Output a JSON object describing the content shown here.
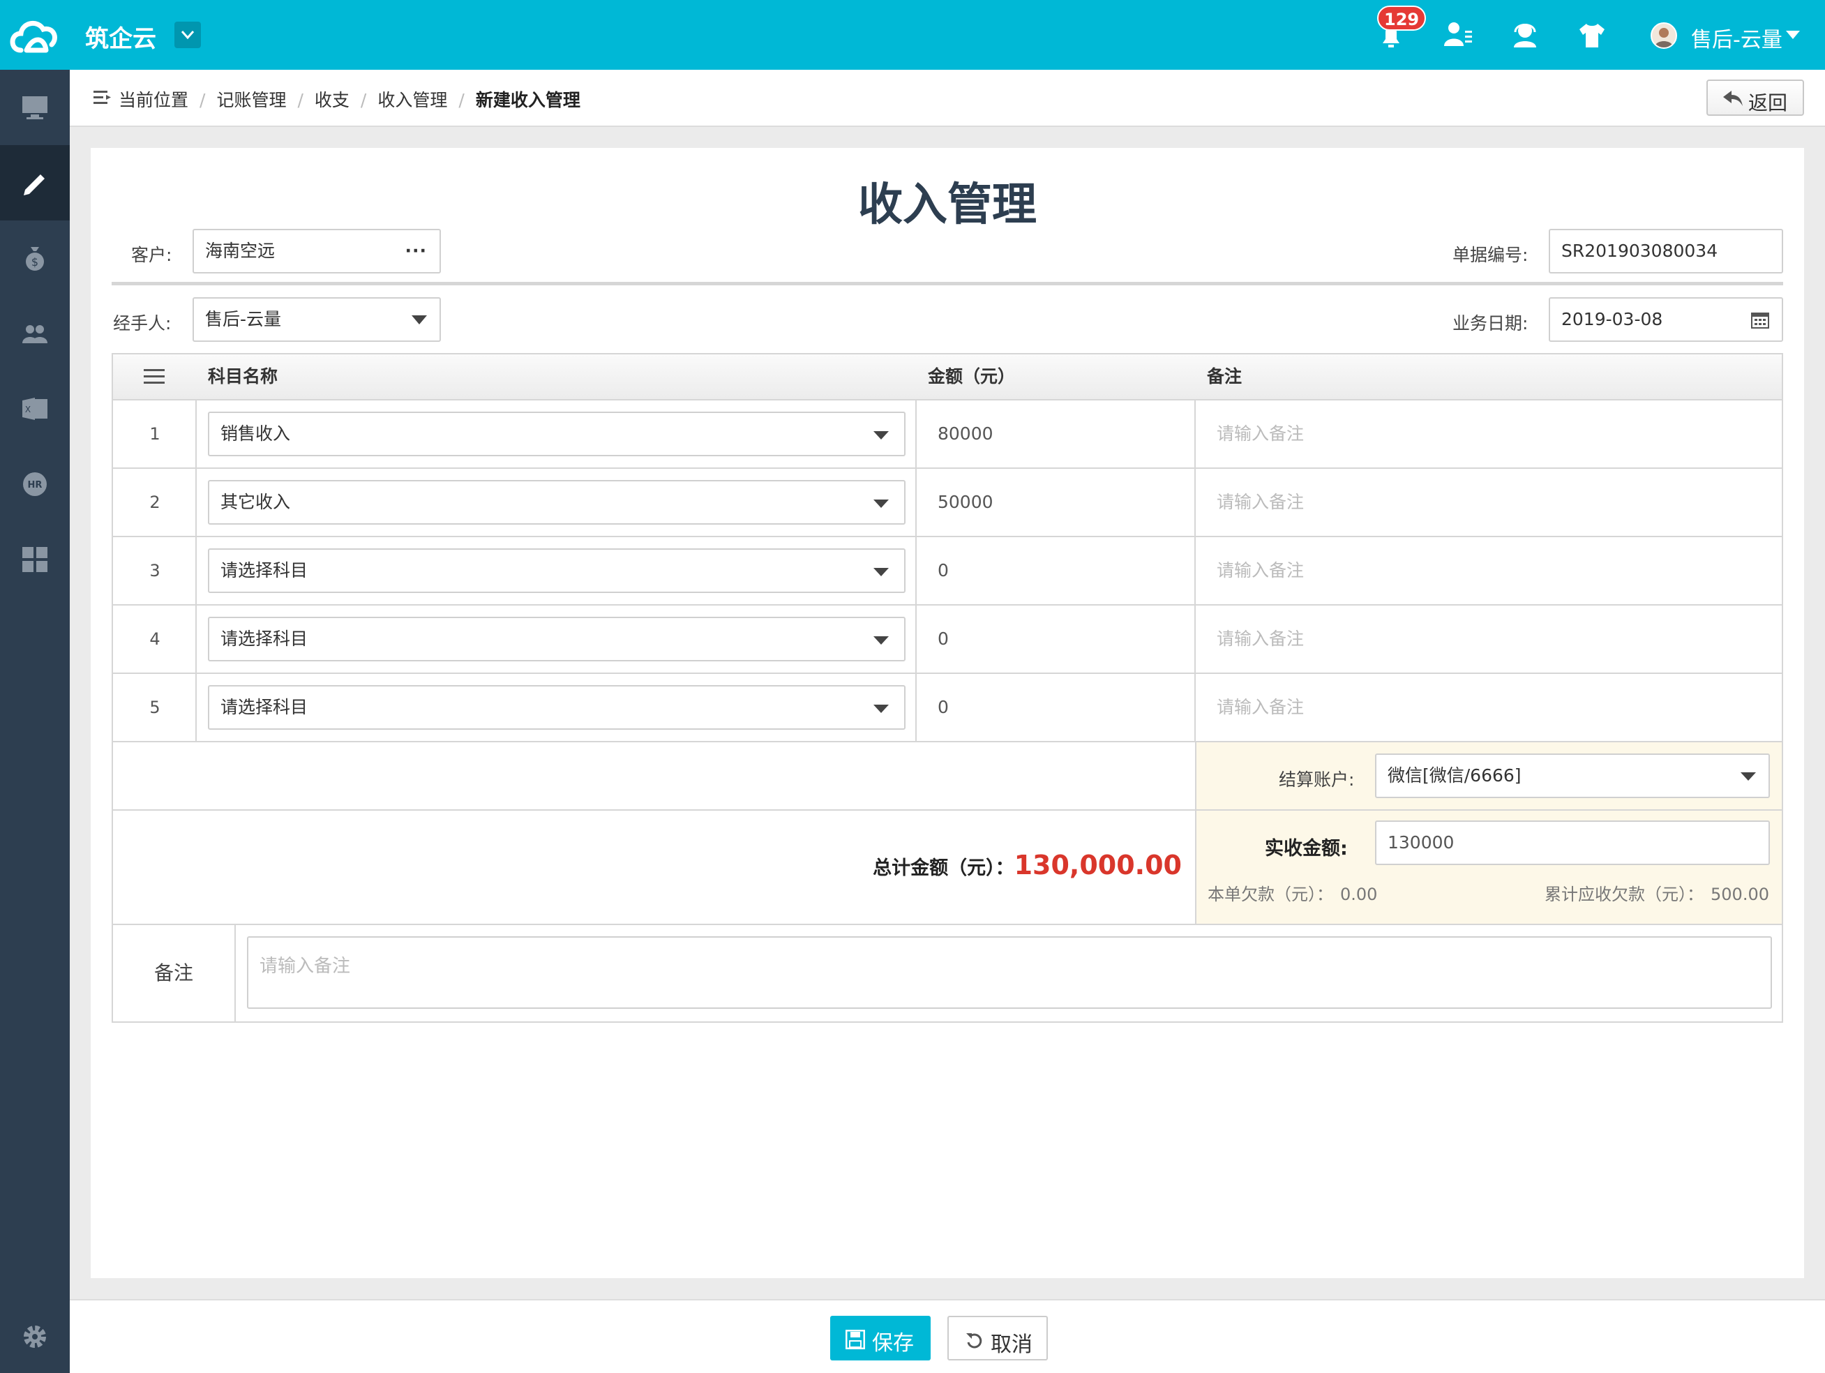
{
  "colors": {
    "accent": "#00b8d6",
    "sidebar": "#2d3e50",
    "total": "#d9362b",
    "badge": "#e53935",
    "summary_bg": "#fdf8e8"
  },
  "header": {
    "brand": "筑企云",
    "notification_count": "129",
    "user_name": "售后-云量",
    "icons": [
      "cloud-logo-icon",
      "chevron-down-icon",
      "bell-icon",
      "user-list-icon",
      "support-icon",
      "shirt-icon",
      "avatar",
      "caret-down-icon"
    ]
  },
  "sidebar": {
    "items": [
      "monitor-icon",
      "pencil-icon",
      "money-bag-icon",
      "group-icon",
      "excel-icon",
      "hr-icon",
      "grid-icon"
    ],
    "footer": "gear-icon"
  },
  "breadcrumb": {
    "items": [
      "当前位置",
      "记账管理",
      "收支",
      "收入管理",
      "新建收入管理"
    ],
    "back_label": "返回"
  },
  "form": {
    "title": "收入管理",
    "customer_label": "客户:",
    "customer_value": "海南空远",
    "doc_no_label": "单据编号:",
    "doc_no_value": "SR201903080034",
    "handler_label": "经手人:",
    "handler_value": "售后-云量",
    "date_label": "业务日期:",
    "date_value": "2019-03-08"
  },
  "table": {
    "columns": [
      "科目名称",
      "金额（元）",
      "备注"
    ],
    "rows": [
      {
        "index": "1",
        "subject": "销售收入",
        "amount": "80000",
        "note_placeholder": "请输入备注"
      },
      {
        "index": "2",
        "subject": "其它收入",
        "amount": "50000",
        "note_placeholder": "请输入备注"
      },
      {
        "index": "3",
        "subject": "请选择科目",
        "amount": "0",
        "note_placeholder": "请输入备注"
      },
      {
        "index": "4",
        "subject": "请选择科目",
        "amount": "0",
        "note_placeholder": "请输入备注"
      },
      {
        "index": "5",
        "subject": "请选择科目",
        "amount": "0",
        "note_placeholder": "请输入备注"
      }
    ]
  },
  "summary": {
    "account_label": "结算账户:",
    "account_value": "微信[微信/6666]",
    "total_label": "总计金额（元）：",
    "total_value": "130,000.00",
    "received_label": "实收金额:",
    "received_value": "130000",
    "debt_label": "本单欠款（元）：",
    "debt_value": "0.00",
    "cumulative_label": "累计应收欠款（元）：",
    "cumulative_value": "500.00"
  },
  "remark": {
    "label": "备注",
    "placeholder": "请输入备注"
  },
  "actions": {
    "save": "保存",
    "cancel": "取消"
  }
}
